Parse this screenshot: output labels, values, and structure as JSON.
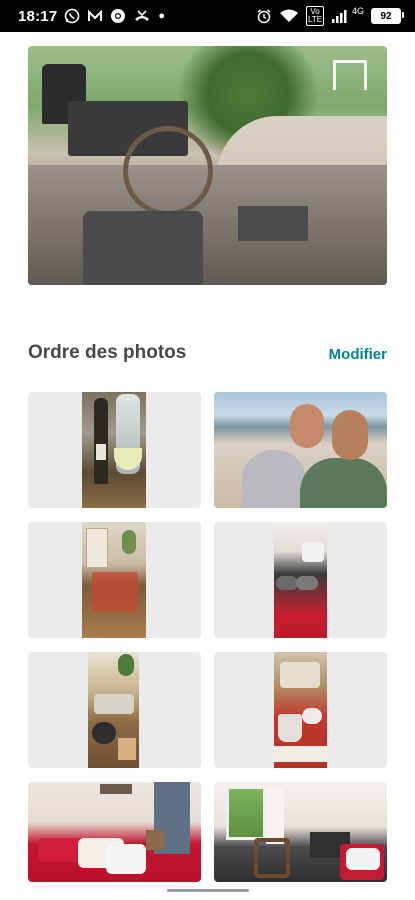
{
  "status_bar": {
    "time": "18:17",
    "network_label": "4G",
    "volte_label": "Vo LTE",
    "battery": "92",
    "left_icons": [
      "whatsapp-icon",
      "notification-m-icon",
      "chrome-icon",
      "missed-call-icon",
      "dot-icon"
    ],
    "right_icons": [
      "alarm-icon",
      "wifi-icon",
      "volte-icon",
      "signal-icon",
      "battery-icon"
    ]
  },
  "photos_section": {
    "title": "Ordre des photos",
    "action_label": "Modifier"
  },
  "colors": {
    "accent": "#008489",
    "title": "#484848",
    "tile_bg": "#ebebeb"
  },
  "photos": [
    {
      "subject": "wine-bottles"
    },
    {
      "subject": "beach-selfie"
    },
    {
      "subject": "dining-table"
    },
    {
      "subject": "bed-towels"
    },
    {
      "subject": "table-setting"
    },
    {
      "subject": "mug-tray"
    },
    {
      "subject": "bedroom-red"
    },
    {
      "subject": "bedroom-window"
    }
  ]
}
